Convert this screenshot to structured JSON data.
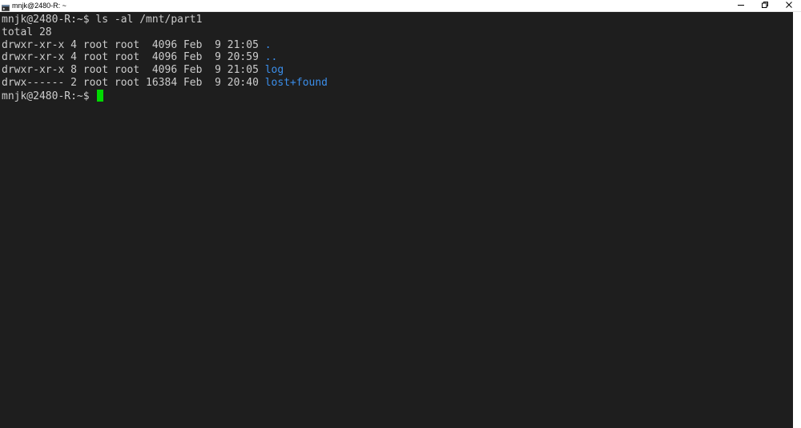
{
  "window": {
    "title": "mnjk@2480-R: ~",
    "app_icon": "terminal-icon",
    "controls": {
      "minimize_icon": "minimize-icon",
      "maximize_icon": "restore-icon",
      "close_icon": "close-icon"
    }
  },
  "terminal": {
    "prompt_line": {
      "prompt": "mnjk@2480-R:~$ ",
      "command": "ls -al /mnt/part1"
    },
    "total_line": "total 28",
    "entries": [
      {
        "info": "drwxr-xr-x 4 root root  4096 Feb  9 21:05 ",
        "name": "."
      },
      {
        "info": "drwxr-xr-x 4 root root  4096 Feb  9 20:59 ",
        "name": ".."
      },
      {
        "info": "drwxr-xr-x 8 root root  4096 Feb  9 21:05 ",
        "name": "log"
      },
      {
        "info": "drwx------ 2 root root 16384 Feb  9 20:40 ",
        "name": "lost+found"
      }
    ],
    "final_prompt": "mnjk@2480-R:~$"
  },
  "colors": {
    "background": "#1e1e1e",
    "text": "#cccccc",
    "directory": "#3b8eea",
    "cursor": "#00d900"
  }
}
